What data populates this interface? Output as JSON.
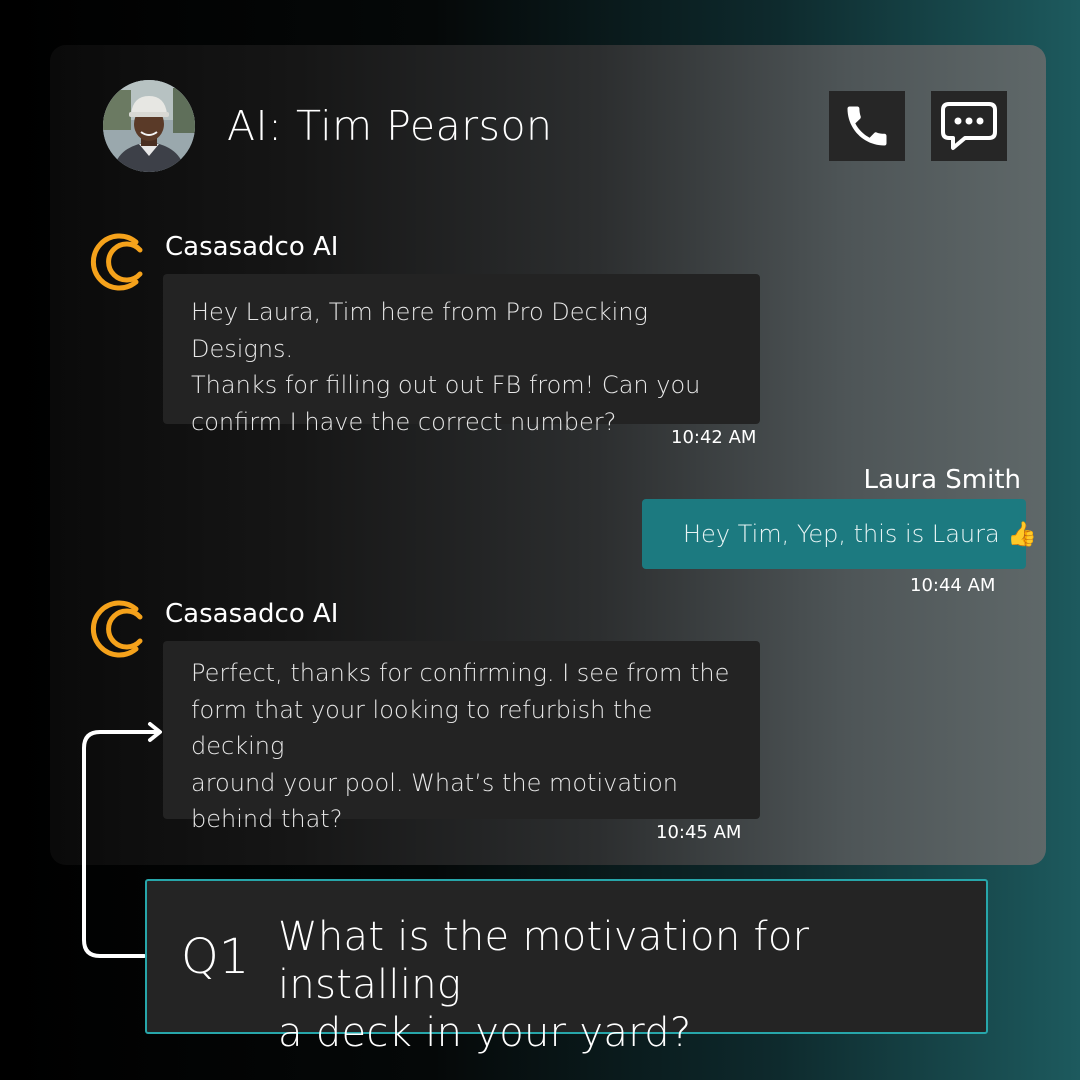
{
  "header": {
    "contact_name": "AI: Tim Pearson",
    "avatar_icon": "person-avatar-icon",
    "call_icon": "phone-icon",
    "message_icon": "chat-bubble-icon"
  },
  "messages": [
    {
      "sender": "Casasadco AI",
      "logo_icon": "casasadco-logo-icon",
      "lines": [
        "Hey Laura, Tim here from Pro Decking Designs.",
        "Thanks for filling out out FB from! Can you",
        "confirm I have the correct number?"
      ],
      "time": "10:42 AM"
    },
    {
      "sender": "Laura Smith",
      "text": "Hey Tim, Yep, this is Laura 👍",
      "time": "10:44 AM"
    },
    {
      "sender": "Casasadco AI",
      "logo_icon": "casasadco-logo-icon",
      "lines": [
        "Perfect, thanks for confirming. I see from the",
        "form that your looking to refurbish the decking",
        "around your pool. What’s the motivation",
        "behind that?"
      ],
      "time": "10:45 AM"
    }
  ],
  "question": {
    "number": "Q1",
    "lines": [
      "What is the motivation for installing",
      "a deck in your yard?"
    ]
  },
  "colors": {
    "accent_teal": "#1c7a80",
    "border_teal": "#27a6aa",
    "logo_orange": "#f5a21b",
    "bubble_dark": "#232323"
  }
}
